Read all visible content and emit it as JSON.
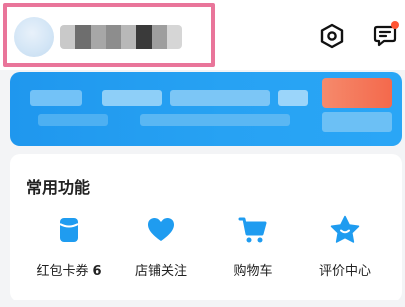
{
  "header": {
    "avatar_icon": "user-avatar-icon",
    "settings_icon": "settings-icon",
    "messages_icon": "chat-message-icon",
    "messages_badge_color": "#ff5533",
    "highlight_color": "#e9759a"
  },
  "banner": {
    "colors": {
      "primary": "#1f97ee",
      "accent": "#f4694c"
    }
  },
  "functions": {
    "title": "常用功能",
    "items": [
      {
        "label": "红包卡券",
        "count": "6",
        "icon": "coupon-icon"
      },
      {
        "label": "店铺关注",
        "icon": "heart-icon"
      },
      {
        "label": "购物车",
        "icon": "cart-icon"
      },
      {
        "label": "评价中心",
        "icon": "star-icon"
      }
    ],
    "icon_color": "#1f9cf0"
  }
}
